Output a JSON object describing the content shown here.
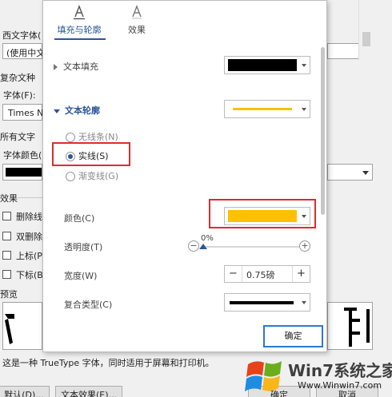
{
  "background_dialog": {
    "western_font_label": "西文字体(",
    "western_font_value": "(使用中文",
    "complex_script_section": "复杂文种",
    "font_label": "字体(F):",
    "font_value": "Times N",
    "all_text_section": "所有文字",
    "font_color_label": "字体颜色(",
    "effects_section": "效果",
    "checkboxes": [
      "删除线",
      "双删除",
      "上标(P",
      "下标(B"
    ],
    "preview_section": "预览",
    "truetype_note": "这是一种 TrueType 字体，同时适用于屏幕和打印机。",
    "default_button": "默认(D)...",
    "text_effects_button": "文本效果(E)...",
    "ok_button_partial": "确定",
    "cancel_partial": "取消"
  },
  "panel": {
    "tabs": [
      {
        "label": "填充与轮廓",
        "icon": "text-fill-outline-icon",
        "active": true
      },
      {
        "label": "效果",
        "icon": "text-effects-icon",
        "active": false
      }
    ],
    "text_fill": {
      "label": "文本填充",
      "color": "#000000"
    },
    "text_outline": {
      "label": "文本轮廓",
      "color": "#f7c300"
    },
    "line_options": [
      {
        "label": "无线条(N)",
        "selected": false
      },
      {
        "label": "实线(S)",
        "selected": true
      },
      {
        "label": "渐变线(G)",
        "selected": false
      }
    ],
    "color_label": "颜色(C)",
    "color_value": "#ffc000",
    "transparency_label": "透明度(T)",
    "transparency_value": "0%",
    "transparency_level": 0,
    "width_label": "宽度(W)",
    "width_value": "0.75磅",
    "compound_type_label": "复合类型(C)",
    "compound_color": "#000000",
    "ok_button": "确定"
  },
  "watermark": {
    "title": "Win7系统之家",
    "url": "Www.Winwin7.com"
  }
}
